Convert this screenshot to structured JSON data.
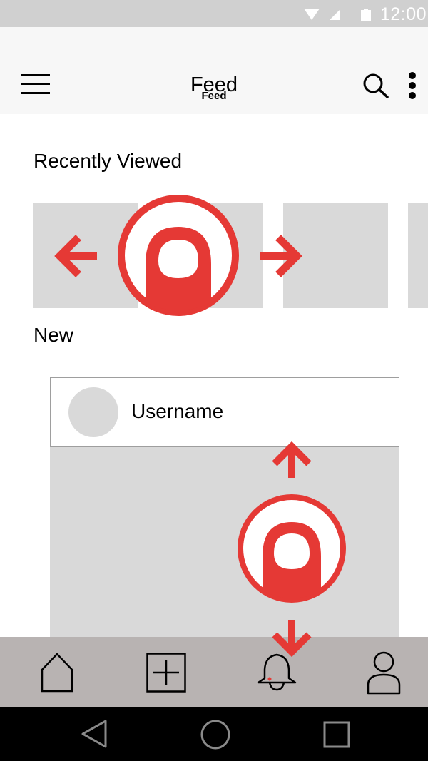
{
  "status_bar": {
    "time": "12:00"
  },
  "app_bar": {
    "title": "Feed",
    "subtitle": "Feed"
  },
  "sections": {
    "recently_viewed": "Recently Viewed",
    "new": "New"
  },
  "post": {
    "username": "Username"
  },
  "bottom_nav": {
    "items": [
      "home-icon",
      "add-icon",
      "notifications-icon",
      "profile-icon"
    ]
  },
  "system_nav": {
    "items": [
      "back-icon",
      "home-circle-icon",
      "recents-icon"
    ]
  },
  "gesture_hints": {
    "horizontal_swipe": "swipe-left-right",
    "vertical_swipe": "swipe-up-down"
  },
  "colors": {
    "accent_red": "#e53935",
    "placeholder_gray": "#d9d9d9",
    "bottom_nav_bg": "#b8b3b2",
    "status_bar_bg": "#d0d0d0"
  }
}
